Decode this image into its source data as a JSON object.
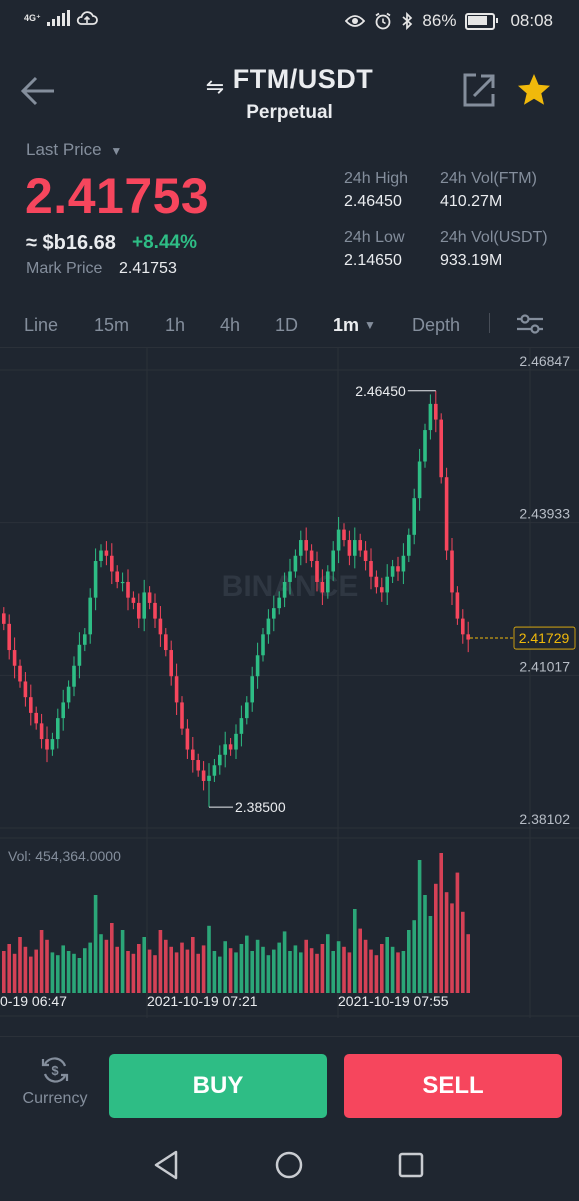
{
  "status_bar": {
    "network": "4G⁺",
    "battery": "86%",
    "time": "08:08"
  },
  "header": {
    "pair": "FTM/USDT",
    "subtitle": "Perpetual"
  },
  "price": {
    "last_price_label": "Last Price",
    "last_price": "2.41753",
    "approx": "≈ $b16.68",
    "change": "+8.44%",
    "mark_price_label": "Mark Price",
    "mark_price": "2.41753"
  },
  "stats": {
    "high_label": "24h High",
    "high": "2.46450",
    "vol_base_label": "24h Vol(FTM)",
    "vol_base": "410.27M",
    "low_label": "24h Low",
    "low": "2.14650",
    "vol_quote_label": "24h Vol(USDT)",
    "vol_quote": "933.19M"
  },
  "intervals": {
    "line": "Line",
    "m15": "15m",
    "h1": "1h",
    "h4": "4h",
    "d1": "1D",
    "m1": "1m",
    "depth": "Depth"
  },
  "chart": {
    "watermark": "BINANCE",
    "y_ticks": [
      "2.46847",
      "2.43933",
      "2.41017",
      "2.38102"
    ],
    "current_price": "2.41729",
    "high_marker": "2.46450",
    "low_marker": "2.38500",
    "volume_label": "Vol: 454,364.0000",
    "time_labels": [
      "0-19 06:47",
      "2021-10-19 07:21",
      "2021-10-19 07:55"
    ],
    "colors": {
      "up": "#2ebd85",
      "down": "#f6465d",
      "grid": "#2b3139",
      "current": "#f0b90b"
    }
  },
  "chart_data": {
    "type": "candlestick",
    "ylim": [
      2.38102,
      2.46847
    ],
    "y_ticks": [
      2.46847,
      2.43933,
      2.41017,
      2.38102
    ],
    "current_price": 2.41729,
    "high": 2.4645,
    "low": 2.385,
    "x_labels": [
      "0-19 06:47",
      "2021-10-19 07:21",
      "2021-10-19 07:55"
    ],
    "volume_label": "Vol: 454,364.0000",
    "closes": [
      2.42,
      2.415,
      2.412,
      2.409,
      2.406,
      2.403,
      2.401,
      2.398,
      2.396,
      2.398,
      2.402,
      2.405,
      2.408,
      2.412,
      2.416,
      2.418,
      2.425,
      2.432,
      2.434,
      2.433,
      2.43,
      2.428,
      2.428,
      2.425,
      2.424,
      2.421,
      2.426,
      2.424,
      2.421,
      2.418,
      2.415,
      2.41,
      2.405,
      2.4,
      2.396,
      2.394,
      2.392,
      2.39,
      2.391,
      2.393,
      2.395,
      2.397,
      2.396,
      2.399,
      2.402,
      2.405,
      2.41,
      2.414,
      2.418,
      2.421,
      2.423,
      2.425,
      2.428,
      2.43,
      2.433,
      2.436,
      2.434,
      2.432,
      2.428,
      2.426,
      2.43,
      2.434,
      2.438,
      2.436,
      2.433,
      2.436,
      2.434,
      2.432,
      2.429,
      2.427,
      2.426,
      2.429,
      2.431,
      2.43,
      2.433,
      2.437,
      2.444,
      2.451,
      2.457,
      2.462,
      2.459,
      2.448,
      2.434,
      2.426,
      2.421,
      2.418,
      2.417
    ],
    "volumes": [
      0.3,
      0.35,
      0.28,
      0.4,
      0.33,
      0.26,
      0.31,
      0.45,
      0.38,
      0.29,
      0.27,
      0.34,
      0.3,
      0.28,
      0.25,
      0.32,
      0.36,
      0.7,
      0.42,
      0.38,
      0.5,
      0.33,
      0.45,
      0.3,
      0.28,
      0.35,
      0.4,
      0.31,
      0.27,
      0.45,
      0.38,
      0.33,
      0.29,
      0.36,
      0.31,
      0.4,
      0.28,
      0.34,
      0.48,
      0.3,
      0.26,
      0.37,
      0.32,
      0.29,
      0.35,
      0.41,
      0.3,
      0.38,
      0.33,
      0.27,
      0.31,
      0.36,
      0.44,
      0.3,
      0.34,
      0.29,
      0.38,
      0.32,
      0.28,
      0.35,
      0.42,
      0.3,
      0.37,
      0.33,
      0.29,
      0.6,
      0.46,
      0.38,
      0.31,
      0.27,
      0.35,
      0.4,
      0.33,
      0.29,
      0.3,
      0.45,
      0.52,
      0.95,
      0.7,
      0.55,
      0.78,
      1.0,
      0.72,
      0.64,
      0.86,
      0.58,
      0.42
    ]
  },
  "actions": {
    "currency": "Currency",
    "buy": "BUY",
    "sell": "SELL"
  }
}
